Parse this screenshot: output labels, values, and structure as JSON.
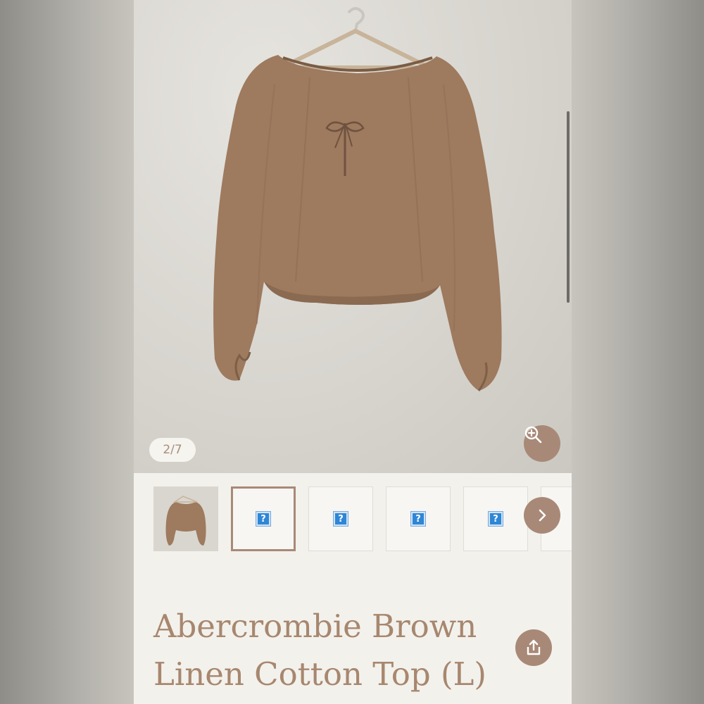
{
  "product": {
    "title_line1": "Abercrombie Brown",
    "title_line2": "Linen Cotton Top (L)"
  },
  "gallery": {
    "counter": "2/7",
    "thumbnails": [
      {
        "kind": "photo"
      },
      {
        "kind": "broken-image",
        "glyph": "?"
      },
      {
        "kind": "broken-image",
        "glyph": "?"
      },
      {
        "kind": "broken-image",
        "glyph": "?"
      },
      {
        "kind": "broken-image",
        "glyph": "?"
      },
      {
        "kind": "broken-image",
        "glyph": "?"
      }
    ]
  },
  "icons": {
    "zoom": "zoom-in-icon",
    "next": "chevron-right-icon",
    "share": "share-icon"
  },
  "colors": {
    "accent": "#a88977",
    "title_text": "#a7876f",
    "background": "#f3f1ec",
    "garment": "#9e7a5e"
  }
}
